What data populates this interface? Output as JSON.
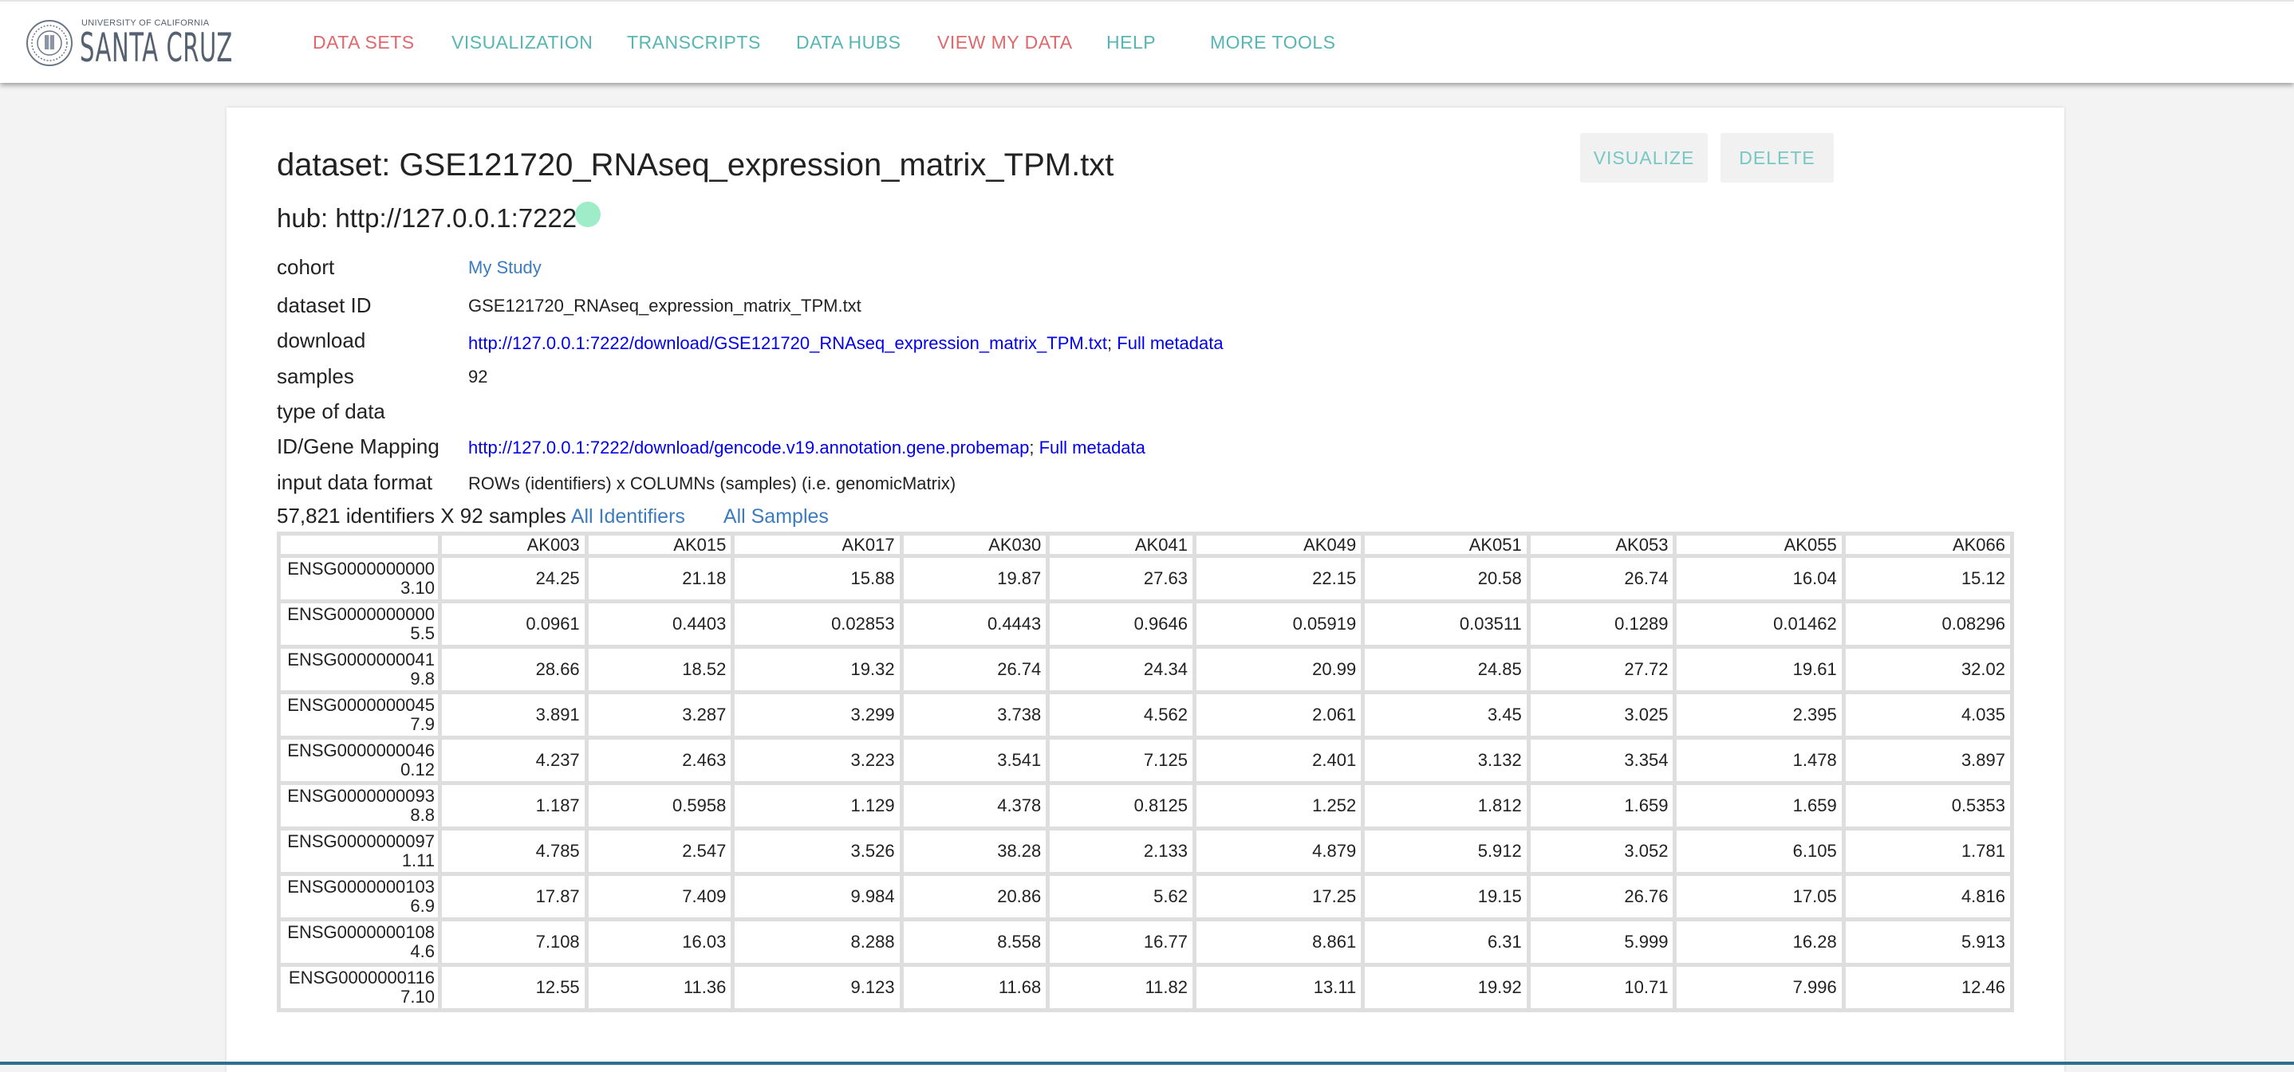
{
  "logo": {
    "small_text": "UNIVERSITY OF CALIFORNIA",
    "big_text": "SANTA CRUZ"
  },
  "nav": [
    {
      "label": "DATA SETS",
      "accent": "red"
    },
    {
      "label": "VISUALIZATION",
      "accent": "teal"
    },
    {
      "label": "TRANSCRIPTS",
      "accent": "teal"
    },
    {
      "label": "DATA HUBS",
      "accent": "teal"
    },
    {
      "label": "VIEW MY DATA",
      "accent": "red"
    },
    {
      "label": "HELP",
      "accent": "teal"
    },
    {
      "label": "MORE TOOLS",
      "accent": "teal"
    }
  ],
  "colors": {
    "nav_red": "#e0686c",
    "nav_teal": "#57b6b3",
    "link_blue": "#0000ee",
    "cohort_link": "#3c7bbf",
    "hub_status": "#9fedc8"
  },
  "dataset": {
    "title": "dataset: GSE121720_RNAseq_expression_matrix_TPM.txt",
    "hub": "hub: http://127.0.0.1:7222",
    "buttons": {
      "visualize": "VISUALIZE",
      "delete": "DELETE"
    }
  },
  "meta": {
    "cohort": {
      "label": "cohort",
      "value": "My Study"
    },
    "dataset_id": {
      "label": "dataset ID",
      "value": "GSE121720_RNAseq_expression_matrix_TPM.txt"
    },
    "download": {
      "label": "download",
      "link": "http://127.0.0.1:7222/download/GSE121720_RNAseq_expression_matrix_TPM.txt",
      "sep": "; ",
      "meta_link": "Full metadata"
    },
    "samples": {
      "label": "samples",
      "value": "92"
    },
    "type_of_data": {
      "label": "type of data",
      "value": ""
    },
    "id_mapping": {
      "label": "ID/Gene Mapping",
      "link": "http://127.0.0.1:7222/download/gencode.v19.annotation.gene.probemap",
      "sep": "; ",
      "meta_link": "Full metadata"
    },
    "input_format": {
      "label": "input data format",
      "value": "ROWs (identifiers) x COLUMNs (samples) (i.e. genomicMatrix)"
    }
  },
  "counts": {
    "text": "57,821 identifiers X 92 samples",
    "all_identifiers": "All Identifiers",
    "all_samples": "All Samples"
  },
  "table": {
    "columns": [
      "AK003",
      "AK015",
      "AK017",
      "AK030",
      "AK041",
      "AK049",
      "AK051",
      "AK053",
      "AK055",
      "AK066"
    ],
    "rows": [
      {
        "id_line1": "ENSG0000000000",
        "id_line2": "3.10",
        "values": [
          "24.25",
          "21.18",
          "15.88",
          "19.87",
          "27.63",
          "22.15",
          "20.58",
          "26.74",
          "16.04",
          "15.12"
        ]
      },
      {
        "id_line1": "ENSG0000000000",
        "id_line2": "5.5",
        "values": [
          "0.0961",
          "0.4403",
          "0.02853",
          "0.4443",
          "0.9646",
          "0.05919",
          "0.03511",
          "0.1289",
          "0.01462",
          "0.08296"
        ]
      },
      {
        "id_line1": "ENSG0000000041",
        "id_line2": "9.8",
        "values": [
          "28.66",
          "18.52",
          "19.32",
          "26.74",
          "24.34",
          "20.99",
          "24.85",
          "27.72",
          "19.61",
          "32.02"
        ]
      },
      {
        "id_line1": "ENSG0000000045",
        "id_line2": "7.9",
        "values": [
          "3.891",
          "3.287",
          "3.299",
          "3.738",
          "4.562",
          "2.061",
          "3.45",
          "3.025",
          "2.395",
          "4.035"
        ]
      },
      {
        "id_line1": "ENSG0000000046",
        "id_line2": "0.12",
        "values": [
          "4.237",
          "2.463",
          "3.223",
          "3.541",
          "7.125",
          "2.401",
          "3.132",
          "3.354",
          "1.478",
          "3.897"
        ]
      },
      {
        "id_line1": "ENSG0000000093",
        "id_line2": "8.8",
        "values": [
          "1.187",
          "0.5958",
          "1.129",
          "4.378",
          "0.8125",
          "1.252",
          "1.812",
          "1.659",
          "1.659",
          "0.5353"
        ]
      },
      {
        "id_line1": "ENSG0000000097",
        "id_line2": "1.11",
        "values": [
          "4.785",
          "2.547",
          "3.526",
          "38.28",
          "2.133",
          "4.879",
          "5.912",
          "3.052",
          "6.105",
          "1.781"
        ]
      },
      {
        "id_line1": "ENSG0000000103",
        "id_line2": "6.9",
        "values": [
          "17.87",
          "7.409",
          "9.984",
          "20.86",
          "5.62",
          "17.25",
          "19.15",
          "26.76",
          "17.05",
          "4.816"
        ]
      },
      {
        "id_line1": "ENSG0000000108",
        "id_line2": "4.6",
        "values": [
          "7.108",
          "16.03",
          "8.288",
          "8.558",
          "16.77",
          "8.861",
          "6.31",
          "5.999",
          "16.28",
          "5.913"
        ]
      },
      {
        "id_line1": "ENSG0000000116",
        "id_line2": "7.10",
        "values": [
          "12.55",
          "11.36",
          "9.123",
          "11.68",
          "11.82",
          "13.11",
          "19.92",
          "10.71",
          "7.996",
          "12.46"
        ]
      }
    ]
  }
}
